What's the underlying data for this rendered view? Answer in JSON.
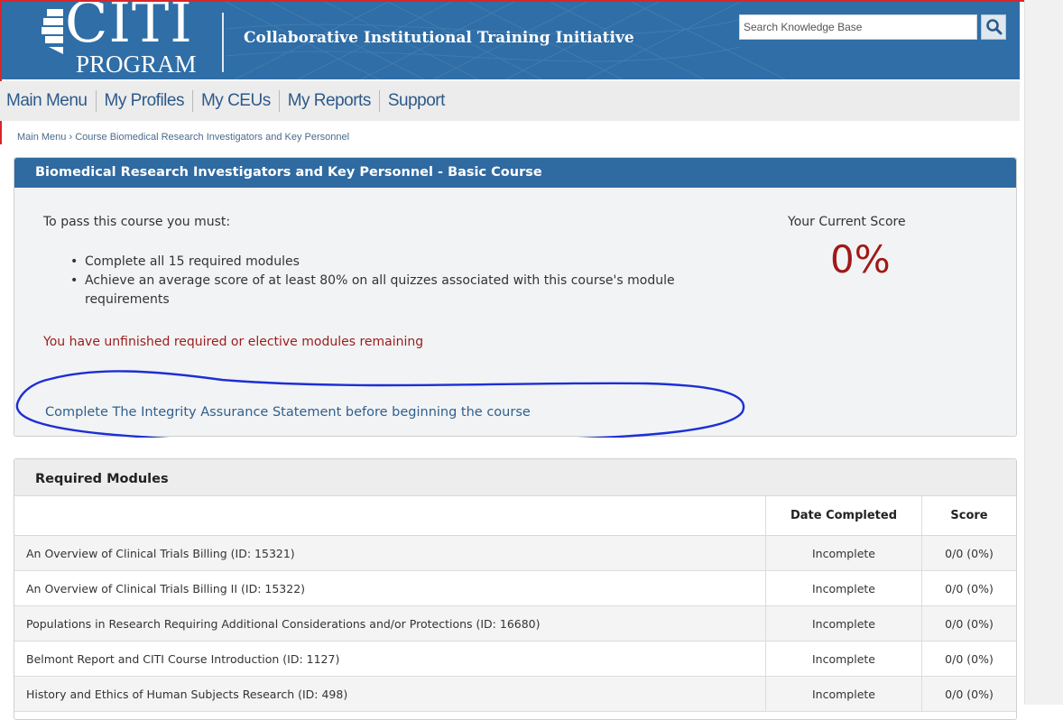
{
  "header": {
    "logo_word": "CITI",
    "logo_program": "PROGRAM",
    "org_name": "Collaborative Institutional Training Initiative",
    "search_placeholder": "Search Knowledge Base",
    "colors": {
      "header_bg": "#2f6ea6",
      "link": "#2f5f8f",
      "warning": "#9b1c1c"
    }
  },
  "nav": {
    "items": [
      "Main Menu",
      "My Profiles",
      "My CEUs",
      "My Reports",
      "Support"
    ]
  },
  "breadcrumb": "Main Menu › Course Biomedical Research Investigators and Key Personnel",
  "course": {
    "title": "Biomedical Research Investigators and Key Personnel - Basic Course",
    "requirements_intro": "To pass this course you must:",
    "requirements": [
      "Complete all 15 required modules",
      "Achieve an average score of at least 80% on all quizzes associated with this course's module requirements"
    ],
    "warning": "You have unfinished required or elective modules remaining",
    "integrity_link": "Complete The Integrity Assurance Statement before beginning the course",
    "score_label": "Your Current Score",
    "score_value": "0%"
  },
  "modules": {
    "title": "Required Modules",
    "columns": [
      "",
      "Date Completed",
      "Score"
    ],
    "rows": [
      {
        "name": "An Overview of Clinical Trials Billing (ID: 15321)",
        "date": "Incomplete",
        "score": "0/0 (0%)"
      },
      {
        "name": "An Overview of Clinical Trials Billing II (ID: 15322)",
        "date": "Incomplete",
        "score": "0/0 (0%)"
      },
      {
        "name": "Populations in Research Requiring Additional Considerations and/or Protections (ID: 16680)",
        "date": "Incomplete",
        "score": "0/0 (0%)"
      },
      {
        "name": "Belmont Report and CITI Course Introduction (ID: 1127)",
        "date": "Incomplete",
        "score": "0/0 (0%)"
      },
      {
        "name": "History and Ethics of Human Subjects Research (ID: 498)",
        "date": "Incomplete",
        "score": "0/0 (0%)"
      }
    ]
  },
  "icons": {
    "search": "magnifier-icon",
    "logo": "citi-logo-mark"
  }
}
